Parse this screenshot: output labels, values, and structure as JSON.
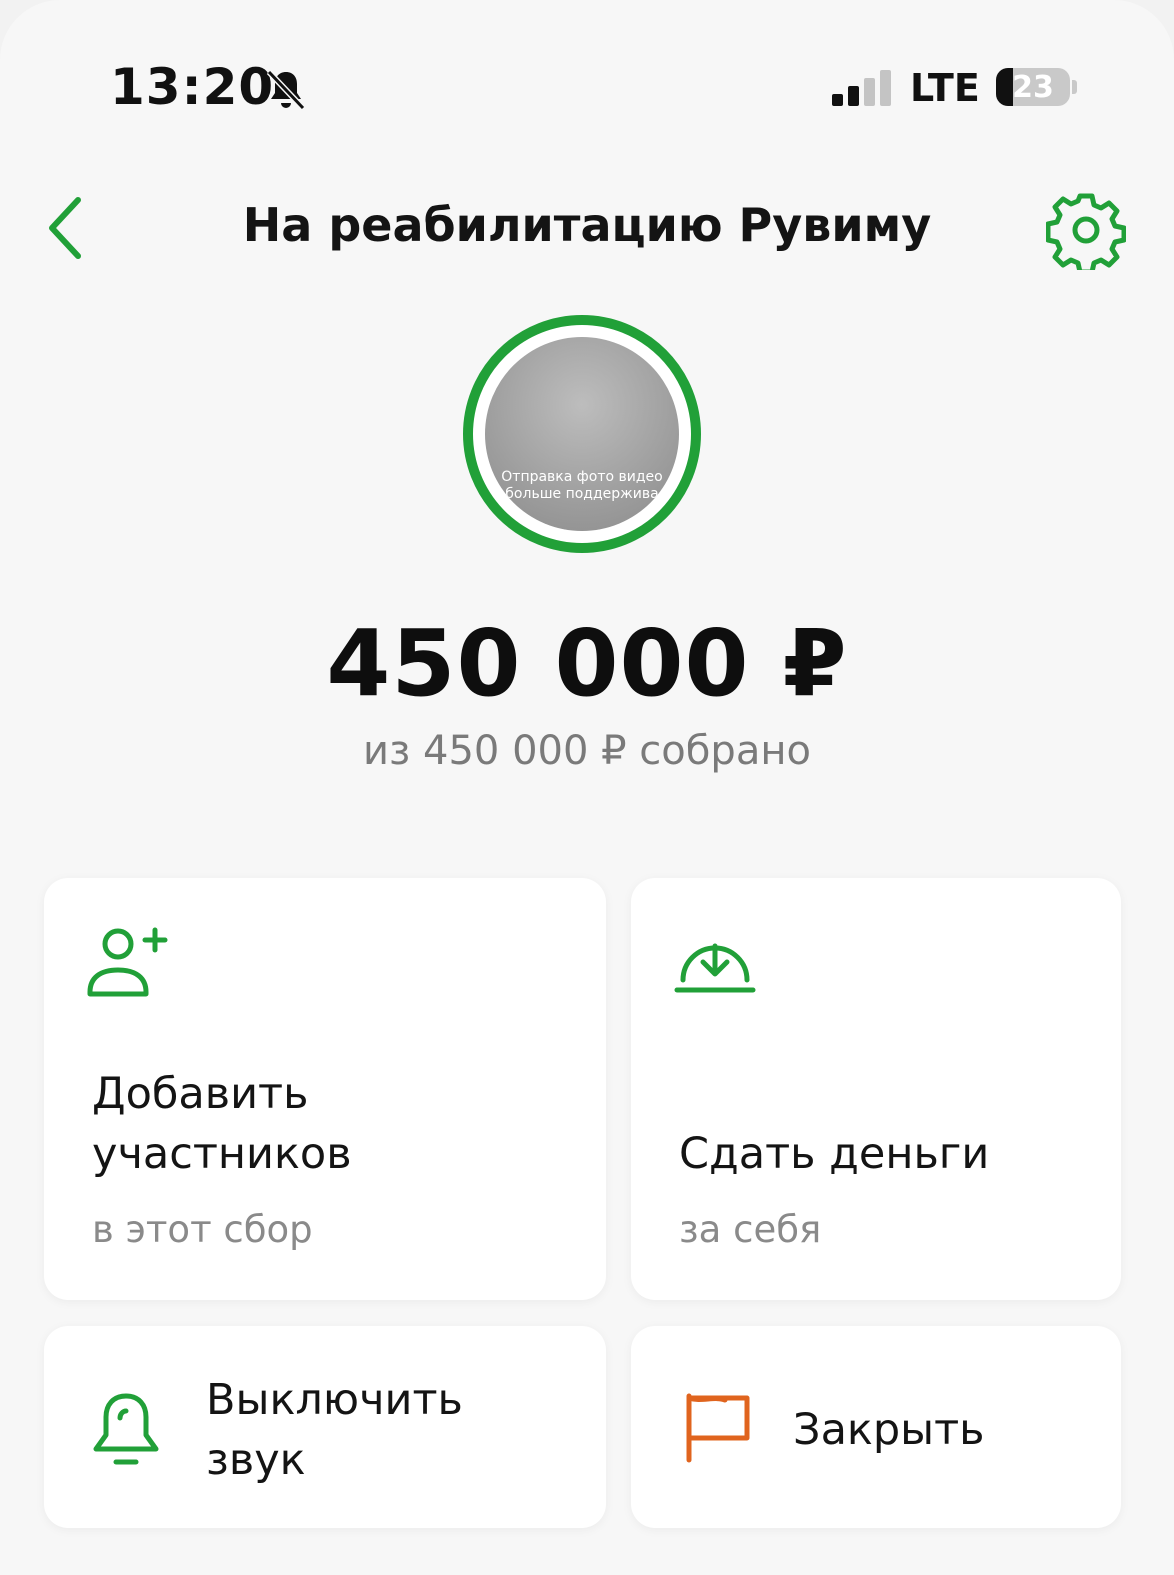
{
  "status_bar": {
    "time": "13:20",
    "network": "LTE",
    "battery_percent": "23",
    "battery_level": 0.23,
    "signal_bars_active": 2,
    "signal_bars_total": 4
  },
  "header": {
    "title": "На реабилитацию Рувиму",
    "back_icon": "chevron-left-icon",
    "settings_icon": "gear-icon"
  },
  "avatar": {
    "caption": "Отправка фото видео больше поддержива"
  },
  "fundraiser": {
    "amount": "450 000 ₽",
    "collected_label": "из 450 000 ₽ собрано",
    "progress": 1.0
  },
  "actions": {
    "add_members": {
      "title": "Добавить участников",
      "subtitle": "в этот сбор",
      "icon": "add-user-icon"
    },
    "pay": {
      "title": "Сдать деньги",
      "subtitle": "за себя",
      "icon": "download-circle-icon"
    },
    "mute": {
      "title": "Выключить звук",
      "icon": "bell-icon"
    },
    "close": {
      "title": "Закрыть",
      "icon": "flag-icon"
    }
  },
  "colors": {
    "accent_green": "#21a038",
    "close_orange": "#e0641e",
    "background": "#f7f7f7"
  }
}
